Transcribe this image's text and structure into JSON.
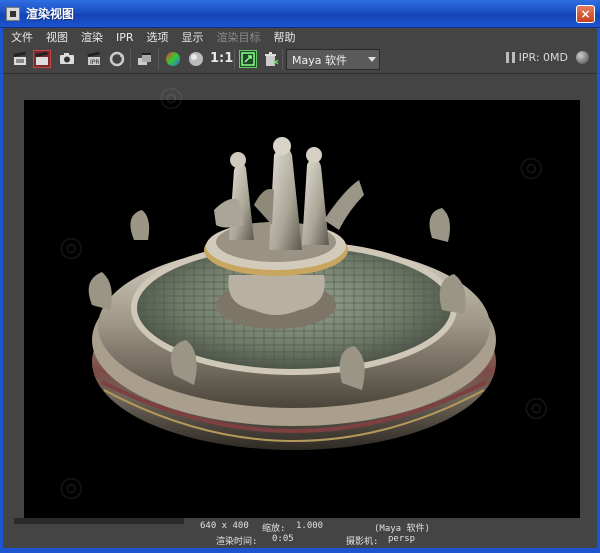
{
  "window": {
    "title": "渲染视图",
    "close_label": "×"
  },
  "menu": {
    "items": [
      "文件",
      "视图",
      "渲染",
      "IPR",
      "选项",
      "显示",
      "渲染目标",
      "帮助"
    ]
  },
  "toolbar": {
    "ratio_label": "1:1",
    "renderer_value": "Maya 软件",
    "ipr_label": "IPR: 0MD",
    "icons": [
      "clapboard-icon",
      "clapboard-region-icon",
      "snapshot-icon",
      "ipr-clapboard-icon",
      "refresh-icon",
      "render-sequence-icon",
      "rgb-channels-icon",
      "alpha-channel-icon",
      "keep-image-icon",
      "remove-image-icon"
    ]
  },
  "render_info": {
    "resolution": "640 x 400",
    "zoom_label": "缩放:",
    "zoom_value": "1.000",
    "renderer_note": "(Maya 软件)",
    "render_time_label": "渲染时间:",
    "render_time_value": "0:05",
    "camera_label": "摄影机:",
    "camera_value": "persp"
  },
  "colors": {
    "titlebar": "#1d55d0",
    "ui_background": "#444444",
    "render_background": "#000000"
  }
}
